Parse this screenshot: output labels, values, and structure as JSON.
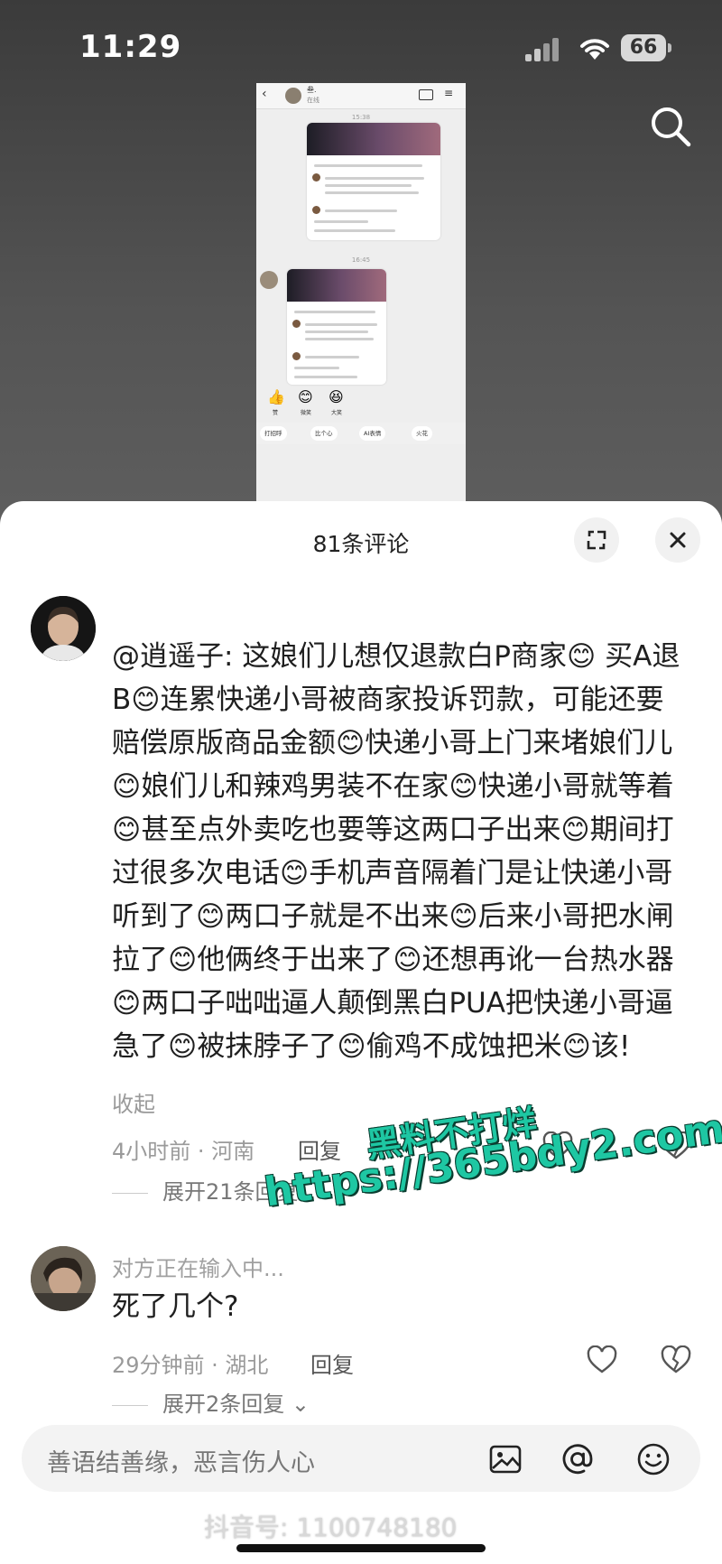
{
  "status_bar": {
    "time": "11:29",
    "battery": "66"
  },
  "chat_preview": {
    "contact_name": "叁.",
    "contact_status": "在线",
    "time_1": "15:38",
    "time_2": "16:45",
    "reactions": [
      {
        "emoji": "👍",
        "label": "赞"
      },
      {
        "emoji": "😊",
        "label": "微笑"
      },
      {
        "emoji": "😆",
        "label": "大笑"
      }
    ],
    "pills": [
      "打招呼",
      "比个心",
      "AI表情",
      "火花"
    ]
  },
  "comments_panel": {
    "title": "81条评论",
    "comments": [
      {
        "text": "@逍遥子: 这娘们儿想仅退款白P商家😊 买A退B😊连累快递小哥被商家投诉罚款，可能还要赔偿原版商品金额😊快递小哥上门来堵娘们儿😊娘们儿和辣鸡男装不在家😊快递小哥就等着😊甚至点外卖吃也要等这两口子出来😊期间打过很多次电话😊手机声音隔着门是让快递小哥听到了😊两口子就是不出来😊后来小哥把水闸拉了😊他俩终于出来了😊还想再讹一台热水器😊两口子咄咄逼人颠倒黑白PUA把快递小哥逼急了😊被抹脖子了😊偷鸡不成蚀把米😊该!",
        "collapse_label": "收起",
        "meta": "4小时前 · 河南",
        "reply_label": "回复",
        "expand_label": "展开21条回复"
      },
      {
        "typing_label": "对方正在输入中...",
        "text": "死了几个?",
        "meta": "29分钟前 · 湖北",
        "reply_label": "回复",
        "expand_label": "展开2条回复"
      }
    ]
  },
  "watermark": {
    "line1": "黑料不打烊",
    "line2": "https://365bdy2.com"
  },
  "input_bar": {
    "placeholder": "善语结善缘，恶言伤人心"
  },
  "footer_watermark": "抖音号: 1100748180",
  "colors": {
    "watermark": "#1ec7a3",
    "sheet_bg": "#ffffff",
    "muted_text": "#9a9a9a"
  }
}
